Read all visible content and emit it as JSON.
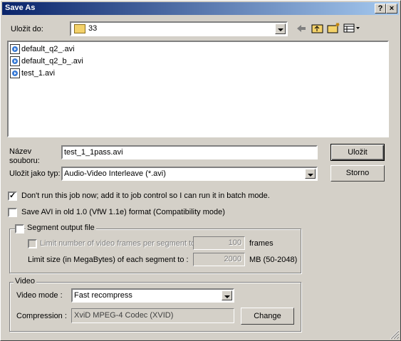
{
  "window": {
    "title": "Save As",
    "help_glyph": "?",
    "close_glyph": "×"
  },
  "save_in": {
    "label": "Uložit do:",
    "folder": "33"
  },
  "toolbar": {
    "icons": [
      "back-arrow-icon",
      "up-folder-icon",
      "new-folder-icon",
      "view-menu-icon"
    ]
  },
  "files": [
    {
      "name": "default_q2_.avi",
      "selected": false
    },
    {
      "name": "default_q2_b_.avi",
      "selected": false
    },
    {
      "name": "test_1.avi",
      "selected": false
    }
  ],
  "filename": {
    "label_line1": "Název",
    "label_line2": "souboru:",
    "value": "test_1_1pass.avi"
  },
  "filetype": {
    "label": "Uložit jako typ:",
    "value": "Audio-Video Interleave (*.avi)"
  },
  "buttons": {
    "save": "Uložit",
    "cancel": "Storno",
    "change": "Change"
  },
  "options": {
    "dont_run": {
      "label": "Don't run this job now; add it to job control so I can run it in batch mode.",
      "checked": true
    },
    "save_old": {
      "label": "Save AVI in old 1.0 (VfW 1.1e) format (Compatibility mode)",
      "checked": false
    }
  },
  "segment": {
    "label": "Segment output file",
    "checked": false,
    "limit_frames_label": "Limit number of video frames per segment to",
    "limit_frames_value": "100",
    "frames_unit": "frames",
    "limit_size_label": "Limit size (in MegaBytes) of each segment to :",
    "limit_size_value": "2000",
    "size_unit": "MB (50-2048)"
  },
  "video": {
    "group_label": "Video",
    "mode_label": "Video mode :",
    "mode_value": "Fast recompress",
    "compression_label": "Compression :",
    "compression_value": "XviD MPEG-4 Codec (XVID)"
  },
  "colors": {
    "titlebar_start": "#0a246a",
    "titlebar_end": "#a6caf0",
    "face": "#d4d0c8"
  }
}
